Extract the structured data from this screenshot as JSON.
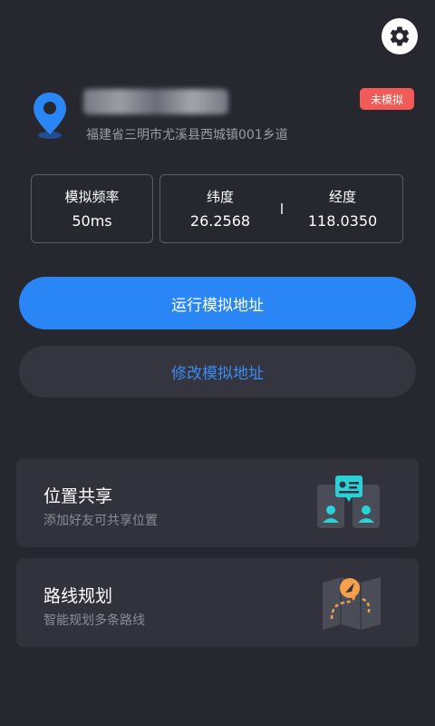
{
  "header": {
    "settings_icon": "gear-icon"
  },
  "location": {
    "icon": "location-pin-icon",
    "address": "福建省三明市尤溪县西城镇001乡道",
    "status_badge": "未模拟"
  },
  "stats": {
    "frequency_label": "模拟频率",
    "frequency_value": "50ms",
    "latitude_label": "纬度",
    "latitude_value": "26.2568",
    "longitude_label": "经度",
    "longitude_value": "118.0350"
  },
  "actions": {
    "run_label": "运行模拟地址",
    "edit_label": "修改模拟地址"
  },
  "features": [
    {
      "title": "位置共享",
      "subtitle": "添加好友可共享位置",
      "icon": "location-share-icon"
    },
    {
      "title": "路线规划",
      "subtitle": "智能规划多条路线",
      "icon": "route-map-icon"
    }
  ],
  "colors": {
    "background": "#26272f",
    "accent": "#2a86f5",
    "badge": "#f15a57",
    "card": "#31323c",
    "teal": "#2ad1d6",
    "orange": "#f7a04a"
  }
}
